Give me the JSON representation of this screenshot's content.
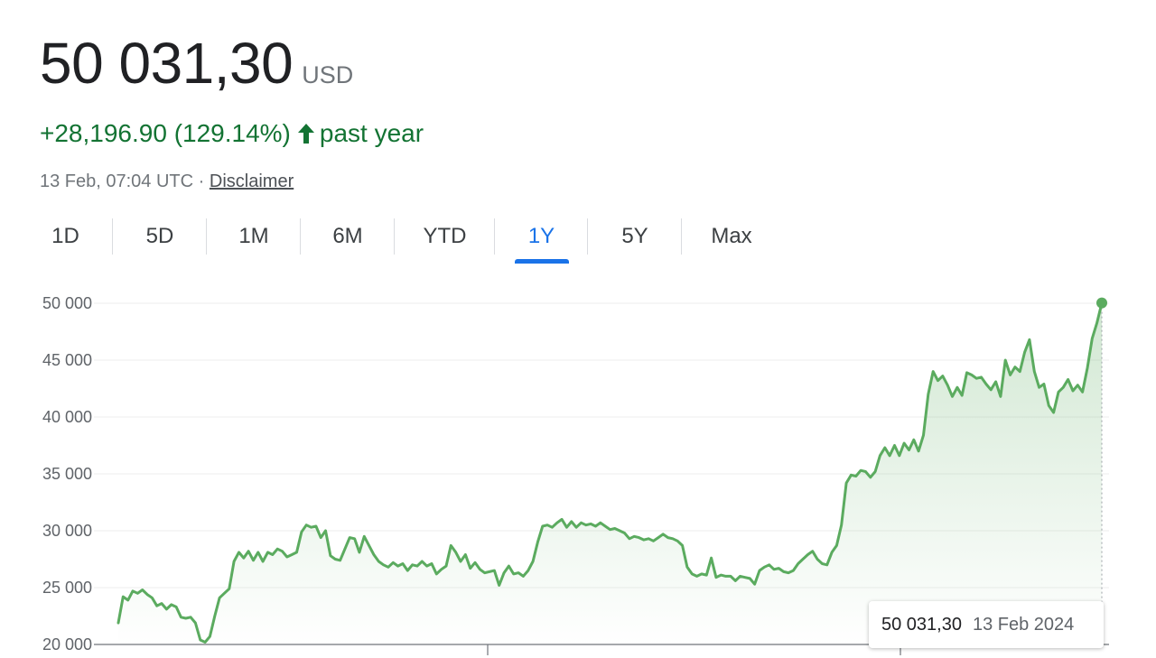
{
  "quote": {
    "price": "50 031,30",
    "currency": "USD",
    "change_text": "+28,196.90 (129.14%)",
    "period_text": "past year",
    "timestamp": "13 Feb, 07:04 UTC",
    "separator": "·",
    "disclaimer": "Disclaimer"
  },
  "colors": {
    "up": "#137333",
    "line": "#5bab5f",
    "accent": "#1a73e8"
  },
  "tabs": [
    {
      "label": "1D",
      "active": false
    },
    {
      "label": "5D",
      "active": false
    },
    {
      "label": "1M",
      "active": false
    },
    {
      "label": "6M",
      "active": false
    },
    {
      "label": "YTD",
      "active": false
    },
    {
      "label": "1Y",
      "active": true
    },
    {
      "label": "5Y",
      "active": false
    },
    {
      "label": "Max",
      "active": false
    }
  ],
  "tooltip": {
    "value": "50 031,30",
    "date": "13 Feb 2024"
  },
  "chart_data": {
    "type": "area",
    "title": "",
    "xlabel": "",
    "ylabel": "",
    "ylim": [
      20000,
      50000
    ],
    "y_ticks": [
      20000,
      25000,
      30000,
      35000,
      40000,
      45000,
      50000
    ],
    "y_tick_labels": [
      "20 000",
      "25 000",
      "30 000",
      "35 000",
      "40 000",
      "45 000",
      "50 000"
    ],
    "grid": true,
    "legend": "none",
    "series": [
      {
        "values": [
          21900,
          24200,
          23900,
          24700,
          24500,
          24800,
          24400,
          24100,
          23400,
          23600,
          23100,
          23500,
          23300,
          22400,
          22300,
          22400,
          21900,
          20400,
          20200,
          20700,
          22500,
          24100,
          24500,
          24900,
          27300,
          28100,
          27600,
          28200,
          27400,
          28100,
          27300,
          28100,
          27900,
          28400,
          28200,
          27700,
          27900,
          28100,
          29900,
          30500,
          30300,
          30400,
          29400,
          30000,
          27800,
          27500,
          27400,
          28400,
          29400,
          29300,
          28100,
          29500,
          28700,
          27900,
          27300,
          27000,
          26800,
          27200,
          26900,
          27100,
          26500,
          27000,
          26900,
          27300,
          26900,
          27100,
          26200,
          26600,
          26900,
          28700,
          28100,
          27300,
          27900,
          26700,
          27200,
          26600,
          26300,
          26400,
          26500,
          25200,
          26300,
          26900,
          26200,
          26300,
          26000,
          26500,
          27300,
          29000,
          30400,
          30500,
          30300,
          30700,
          31000,
          30300,
          30800,
          30300,
          30700,
          30500,
          30600,
          30400,
          30700,
          30400,
          30100,
          30200,
          30000,
          29800,
          29300,
          29500,
          29400,
          29200,
          29300,
          29100,
          29400,
          29700,
          29400,
          29300,
          29100,
          28700,
          26800,
          26200,
          26000,
          26200,
          26100,
          27600,
          25900,
          26100,
          26000,
          26000,
          25600,
          26000,
          25900,
          25800,
          25300,
          26500,
          26800,
          27000,
          26600,
          26700,
          26400,
          26300,
          26500,
          27100,
          27500,
          27900,
          28200,
          27500,
          27100,
          27000,
          28100,
          28700,
          30500,
          34200,
          34900,
          34800,
          35300,
          35200,
          34700,
          35200,
          36600,
          37300,
          36600,
          37500,
          36600,
          37700,
          37100,
          38000,
          37000,
          38400,
          42000,
          44000,
          43200,
          43600,
          42800,
          41800,
          42600,
          41900,
          43900,
          43700,
          43400,
          43500,
          42900,
          42400,
          43100,
          41800,
          45000,
          43700,
          44400,
          44000,
          45700,
          46800,
          44000,
          42600,
          42900,
          41000,
          40400,
          42200,
          42600,
          43300,
          42300,
          42800,
          42200,
          44300,
          46900,
          48300,
          50031
        ]
      }
    ]
  }
}
